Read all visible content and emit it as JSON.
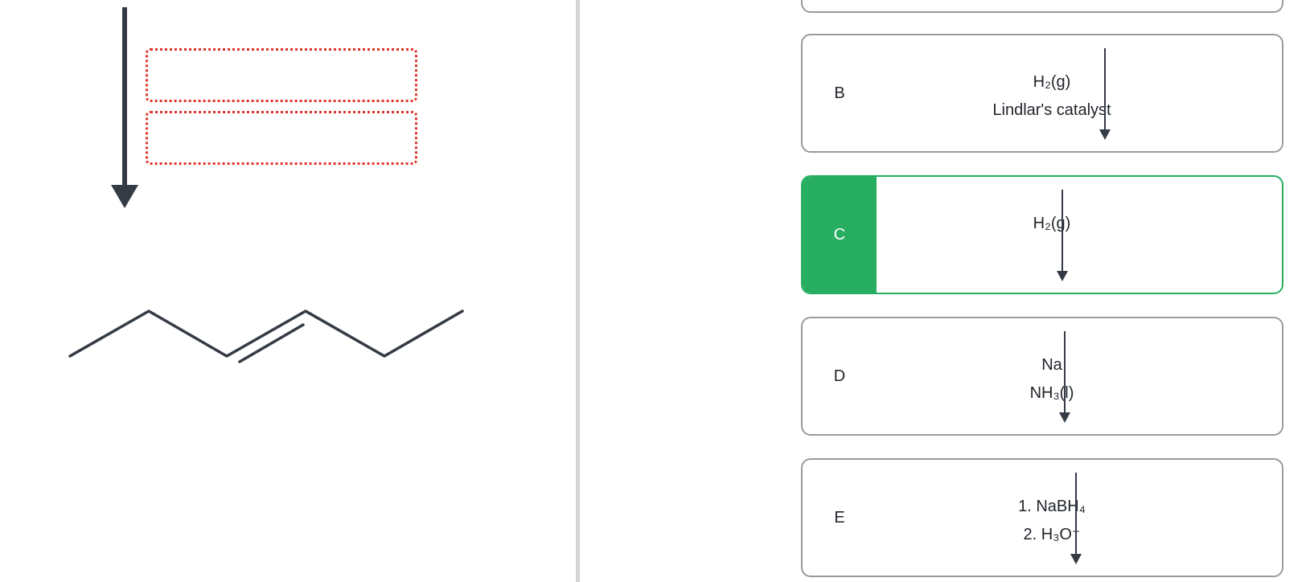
{
  "options": [
    {
      "letter": "",
      "reagent_line1": "",
      "reagent_line2": "",
      "selected": false
    },
    {
      "letter": "B",
      "reagent_line1": "H₂(g)",
      "reagent_line2": "Lindlar's catalyst",
      "selected": false
    },
    {
      "letter": "C",
      "reagent_line1": "H₂(g)",
      "reagent_line2": "",
      "selected": true
    },
    {
      "letter": "D",
      "reagent_line1": "Na",
      "reagent_line2": "NH₃(l)",
      "selected": false
    },
    {
      "letter": "E",
      "reagent_line1": "1. NaBH₄",
      "reagent_line2": "2. H₃O⁺",
      "selected": false
    }
  ],
  "colors": {
    "selected_accent": "#27ae60",
    "card_border": "#9a9a9a",
    "drop_slot_border": "#e0342b",
    "bond_and_arrow": "#353b45",
    "divider": "#d3d3d3"
  },
  "icons": {
    "reaction_arrow": "down-arrow-icon",
    "reagent_arrow": "down-arrow-icon"
  }
}
